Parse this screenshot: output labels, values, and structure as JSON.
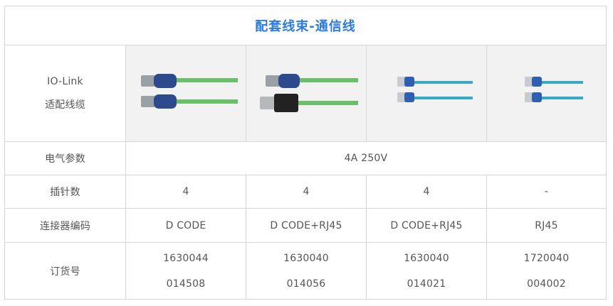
{
  "title": "配套线束-通信线",
  "rows": {
    "cable": {
      "label_line1": "IO-Link",
      "label_line2": "适配线缆",
      "products": [
        {
          "image": "m12-m12-green-cable"
        },
        {
          "image": "m12-rj45-green-cable"
        },
        {
          "image": "rj45-rj45-teal-cable"
        },
        {
          "image": "rj45-rj45-teal-short-cable"
        }
      ]
    },
    "electrical": {
      "label": "电气参数",
      "value": "4A 250V"
    },
    "pins": {
      "label": "插针数",
      "values": [
        "4",
        "4",
        "4",
        "-"
      ]
    },
    "connector": {
      "label": "连接器编码",
      "values": [
        "D CODE",
        "D CODE+RJ45",
        "D CODE+RJ45",
        "RJ45"
      ]
    },
    "order": {
      "label": "订货号",
      "values": [
        {
          "line1": "1630044",
          "line2": "014508"
        },
        {
          "line1": "1630040",
          "line2": "014056"
        },
        {
          "line1": "1630040",
          "line2": "014021"
        },
        {
          "line1": "1720040",
          "line2": "004002"
        }
      ]
    }
  },
  "colors": {
    "title": "#2a7be4",
    "border": "#d6d6d6",
    "green_cable": "#6cbf6a",
    "teal_cable": "#3aa8c4",
    "connector_blue": "#2c4a8c"
  }
}
